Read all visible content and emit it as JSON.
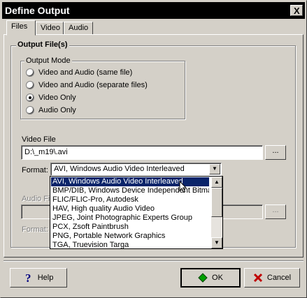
{
  "window": {
    "title": "Define Output",
    "close_glyph": "X"
  },
  "tabs": [
    {
      "label": "Files",
      "active": true
    },
    {
      "label": "Video",
      "active": false
    },
    {
      "label": "Audio",
      "active": false
    }
  ],
  "output_files": {
    "group_label": "Output File(s)",
    "output_mode": {
      "label": "Output Mode",
      "options": [
        {
          "label": "Video and Audio (same file)",
          "selected": false
        },
        {
          "label": "Video and Audio (separate files)",
          "selected": false
        },
        {
          "label": "Video Only",
          "selected": true
        },
        {
          "label": "Audio Only",
          "selected": false
        }
      ]
    },
    "video_file": {
      "label": "Video File",
      "value": "D:\\_m19\\.avi",
      "browse_label": "..."
    },
    "format": {
      "label": "Format:",
      "value": "AVI, Windows Audio Video Interleaved"
    },
    "audio_file": {
      "label": "Audio File",
      "value": "",
      "browse_label": "..."
    },
    "audio_format": {
      "label": "Format:"
    }
  },
  "format_dropdown": {
    "options": [
      "AVI, Windows Audio Video Interleaved",
      "BMP/DIB, Windows Device Independent Bitmap",
      "FLIC/FLIC-Pro, Autodesk",
      "HAV, High quality Audio Video",
      "JPEG, Joint Photographic Experts Group",
      "PCX, Zsoft Paintbrush",
      "PNG, Portable Network Graphics",
      "TGA, Truevision Targa"
    ],
    "selected_index": 0
  },
  "buttons": {
    "help": "Help",
    "ok": "OK",
    "cancel": "Cancel"
  },
  "colors": {
    "selection": "#0a246a",
    "face": "#d4d0c8",
    "ok_icon": "#00a000",
    "cancel_icon": "#c00000",
    "help_icon": "#000080"
  },
  "icons": {
    "help": "question-mark-icon",
    "ok": "green-diamond-icon",
    "cancel": "red-x-icon",
    "dropdown": "triangle-down-icon"
  }
}
